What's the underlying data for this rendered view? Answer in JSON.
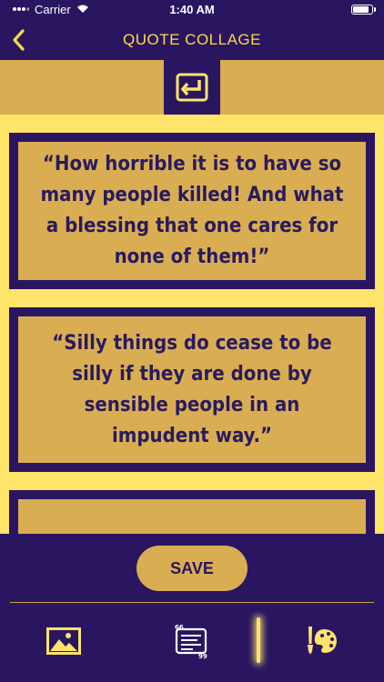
{
  "status_bar": {
    "carrier": "Carrier",
    "time": "1:40 AM"
  },
  "nav": {
    "title": "QUOTE COLLAGE"
  },
  "quotes": [
    {
      "text": "“How horrible it is to have so many people killed! And what a blessing that one cares for none of them!”"
    },
    {
      "text": "“Silly things do cease to be silly if they are done by sensible people in an impudent way.”"
    },
    {
      "text": ""
    }
  ],
  "actions": {
    "save_label": "SAVE"
  },
  "colors": {
    "navy": "#2a1660",
    "gold": "#d9ae52",
    "yellow": "#ffe46a",
    "title_yellow": "#ffd94a"
  },
  "icons": {
    "back": "chevron-left-icon",
    "layout": "return-arrow-icon",
    "image": "image-icon",
    "quotes": "quote-text-icon",
    "palette": "palette-brush-icon"
  }
}
